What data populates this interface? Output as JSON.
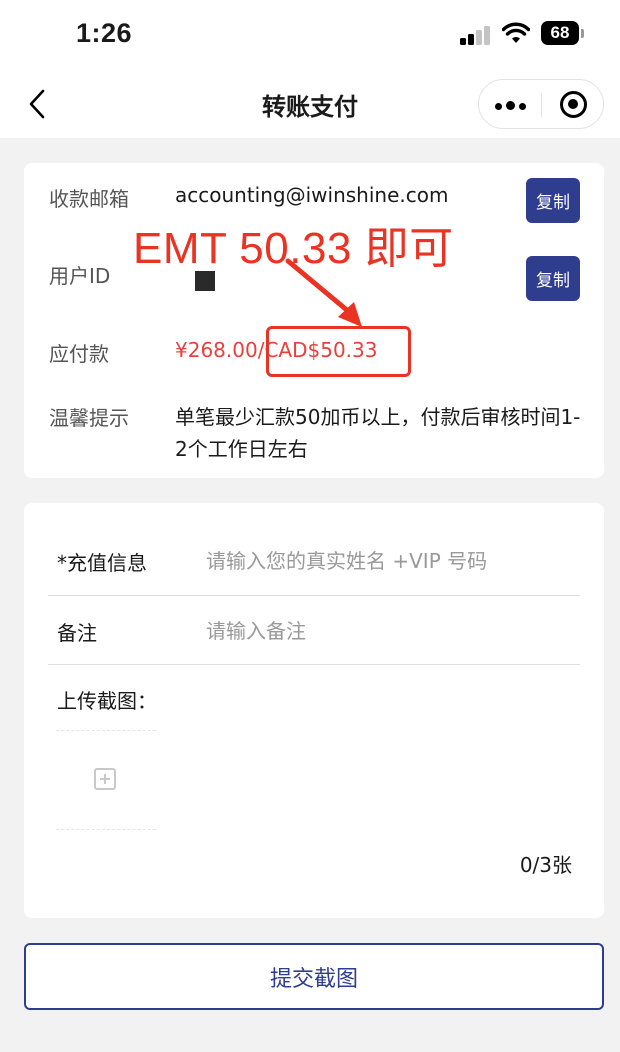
{
  "status_bar": {
    "time": "1:26",
    "battery": "68"
  },
  "nav": {
    "title": "转账支付"
  },
  "info": {
    "email_label": "收款邮箱",
    "email_value": "accounting@iwinshine.com",
    "copy_label": "复制",
    "user_id_label": "用户ID",
    "amount_label": "应付款",
    "amount_value": "¥268.00/CAD$50.33",
    "hint_label": "温馨提示",
    "hint_text": "单笔最少汇款50加币以上，付款后审核时间1-2个工作日左右"
  },
  "form": {
    "recharge_label": "*充值信息",
    "recharge_placeholder": "请输入您的真实姓名 +VIP 号码",
    "note_label": "备注",
    "note_placeholder": "请输入备注",
    "upload_label": "上传截图：",
    "upload_count": "0/3张"
  },
  "submit_label": "提交截图",
  "annotation": {
    "text": "EMT 50.33 即可",
    "color": "#ea3323"
  },
  "colors": {
    "accent": "#2f3d8f",
    "price_red": "#e8403a"
  }
}
